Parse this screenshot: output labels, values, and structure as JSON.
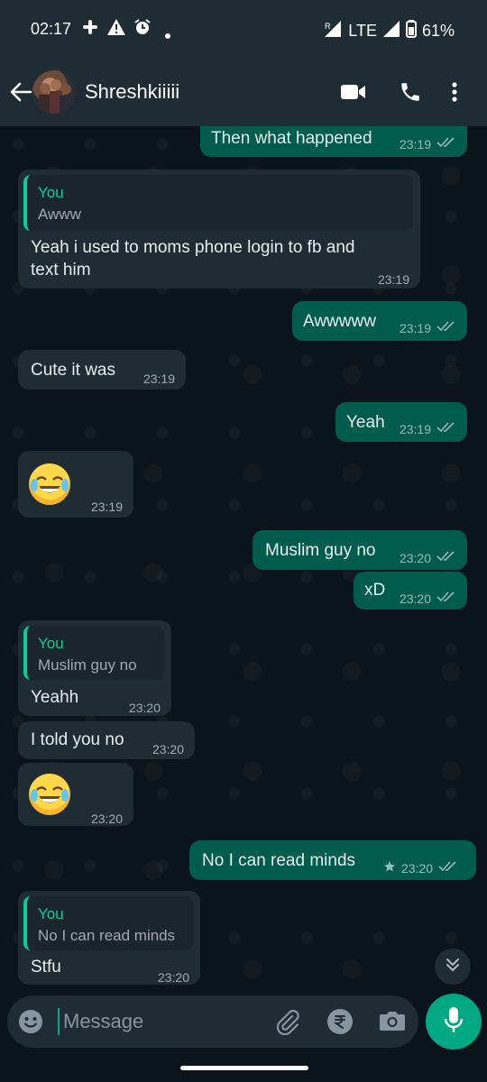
{
  "status_bar": {
    "time": "02:17",
    "network": "LTE",
    "roaming": "R",
    "battery": "61%",
    "icons": [
      "slack-icon",
      "alert-triangle-icon",
      "alarm-icon",
      "dot-icon",
      "signal-icon",
      "battery-icon"
    ]
  },
  "header": {
    "contact_name": "Shreshkiiiii",
    "icons": [
      "back-arrow-icon",
      "avatar",
      "video-call-icon",
      "phone-call-icon",
      "more-vertical-icon"
    ]
  },
  "messages": [
    {
      "dir": "out",
      "text": "Then what happened",
      "time": "23:19",
      "status": "read"
    },
    {
      "dir": "in",
      "quote_author": "You",
      "quote_text": "Awww",
      "text_line1": "Yeah i used to moms phone login to fb and",
      "text_line2": "text him",
      "time": "23:19"
    },
    {
      "dir": "out",
      "text": "Awwwww",
      "time": "23:19",
      "status": "read"
    },
    {
      "dir": "in",
      "text": "Cute it was",
      "time": "23:19"
    },
    {
      "dir": "out",
      "text": "Yeah",
      "time": "23:19",
      "status": "read"
    },
    {
      "dir": "in",
      "emoji": "face-with-tears-of-joy",
      "time": "23:19"
    },
    {
      "dir": "out",
      "text": "Muslim guy no",
      "time": "23:20",
      "status": "read"
    },
    {
      "dir": "out",
      "text": "xD",
      "time": "23:20",
      "status": "read"
    },
    {
      "dir": "in",
      "quote_author": "You",
      "quote_text": "Muslim guy no",
      "text": "Yeahh",
      "time": "23:20"
    },
    {
      "dir": "in",
      "text": "I told you no",
      "time": "23:20"
    },
    {
      "dir": "in",
      "emoji": "face-with-tears-of-joy",
      "time": "23:20"
    },
    {
      "dir": "out",
      "text": "No I can read minds",
      "time": "23:20",
      "status": "read",
      "starred": true
    },
    {
      "dir": "in",
      "quote_author": "You",
      "quote_text": "No I can read minds",
      "text": "Stfu",
      "time": "23:20"
    }
  ],
  "composer": {
    "placeholder": "Message",
    "icons": [
      "emoji-icon",
      "attach-icon",
      "rupee-payment-icon",
      "camera-icon",
      "mic-icon"
    ]
  },
  "colors": {
    "header_bg": "#1f2c34",
    "chat_bg": "#0b141a",
    "outgoing_bubble": "#005c4b",
    "incoming_bubble": "#1f2c34",
    "accent": "#00a884",
    "read_ticks": "#9fb4bd"
  }
}
